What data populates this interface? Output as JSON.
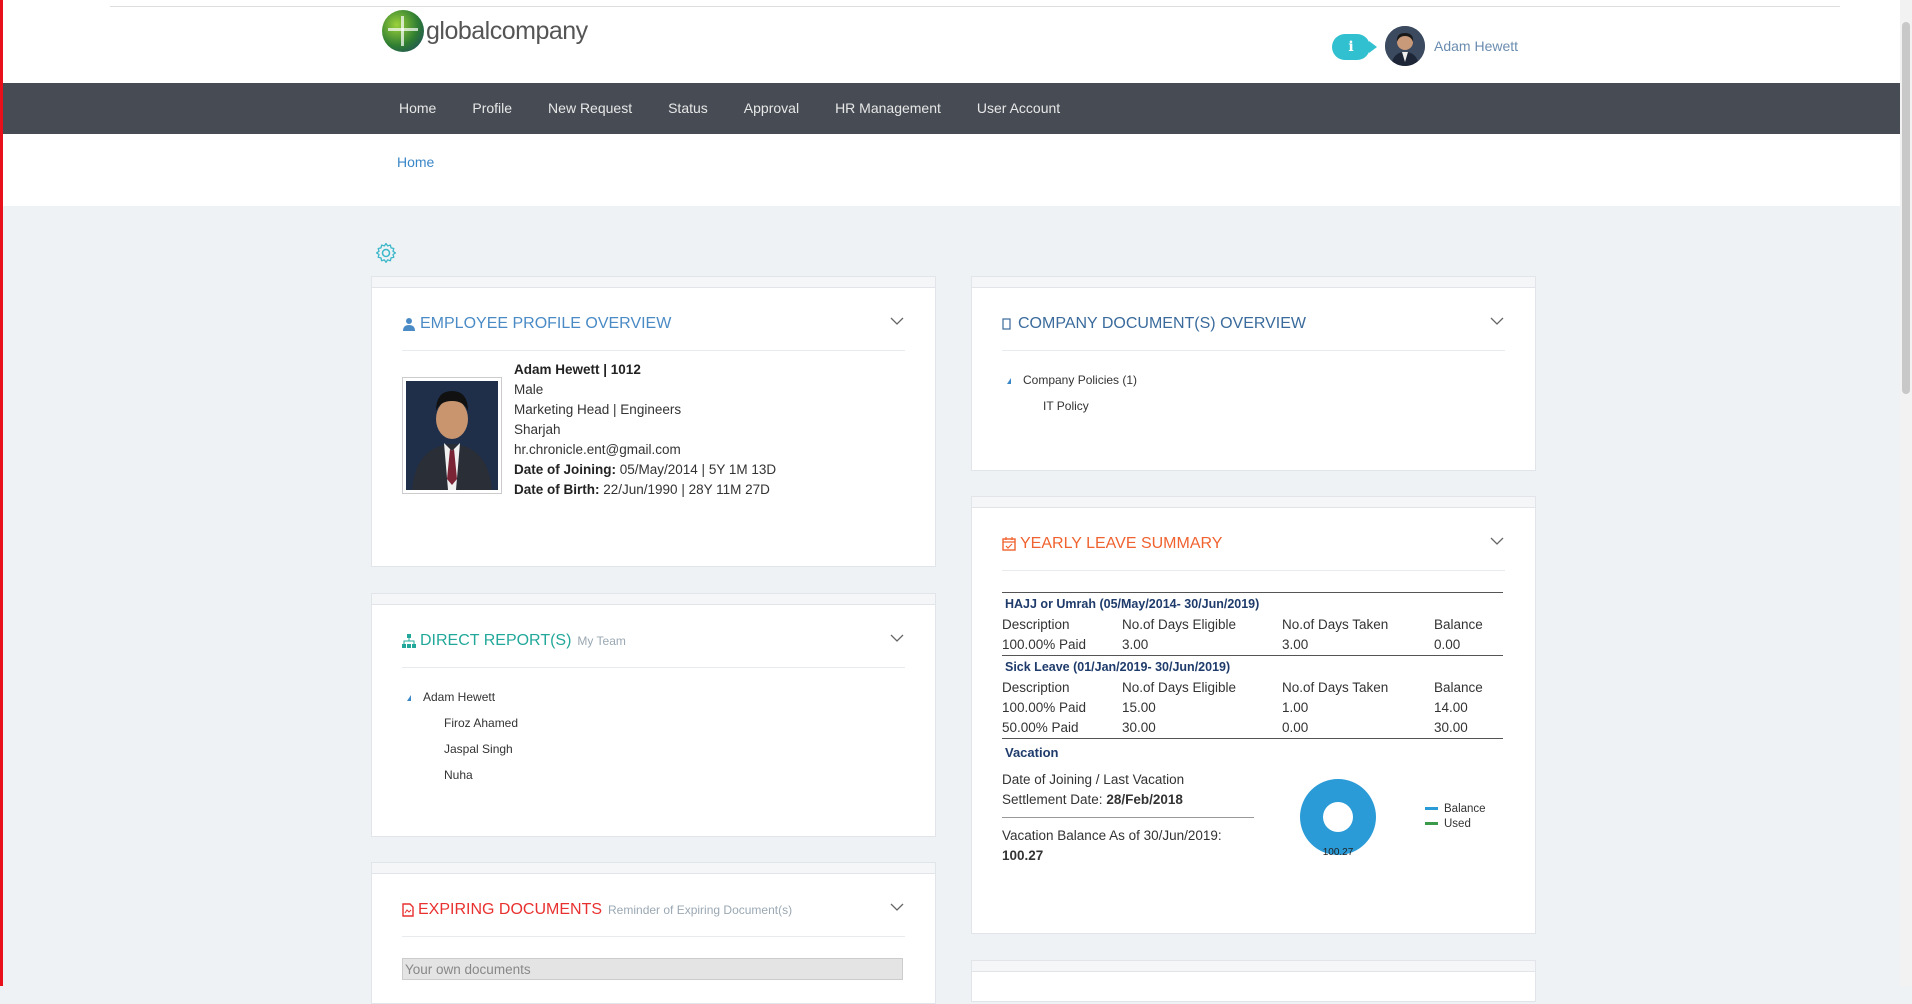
{
  "header": {
    "brand": "globalcompany",
    "info_icon": "i",
    "user_name": "Adam Hewett"
  },
  "nav": {
    "items": [
      "Home",
      "Profile",
      "New Request",
      "Status",
      "Approval",
      "HR Management",
      "User Account"
    ]
  },
  "breadcrumb": {
    "home": "Home"
  },
  "profile": {
    "title": "EMPLOYEE PROFILE OVERVIEW",
    "name_id": "Adam Hewett | 1012",
    "gender": "Male",
    "designation": "Marketing Head | Engineers",
    "location": "Sharjah",
    "email": "hr.chronicle.ent@gmail.com",
    "doj_label": "Date of Joining:",
    "doj_value": " 05/May/2014 | 5Y 1M 13D",
    "dob_label": "Date of Birth:",
    "dob_value": " 22/Jun/1990 | 28Y 11M 27D"
  },
  "reports": {
    "title": "DIRECT REPORT(S)",
    "subtitle": "My Team",
    "manager": "Adam Hewett",
    "members": [
      "Firoz Ahamed",
      "Jaspal Singh",
      "Nuha"
    ]
  },
  "expiring": {
    "title": "EXPIRING DOCUMENTS",
    "subtitle": "Reminder of Expiring Document(s)",
    "placeholder": "Your own documents"
  },
  "company_docs": {
    "title": "COMPANY DOCUMENT(S) OVERVIEW",
    "folder": "Company Policies (1)",
    "items": [
      "IT Policy"
    ]
  },
  "leave": {
    "title": "YEARLY LEAVE SUMMARY",
    "headers": [
      "Description",
      "No.of Days Eligible",
      "No.of Days Taken",
      "Balance"
    ],
    "hajj": {
      "title": "HAJJ or Umrah (05/May/2014- 30/Jun/2019)",
      "rows": [
        [
          "100.00% Paid",
          "3.00",
          "3.00",
          "0.00"
        ]
      ]
    },
    "sick": {
      "title": "Sick Leave (01/Jan/2019- 30/Jun/2019)",
      "rows": [
        [
          "100.00% Paid",
          "15.00",
          "1.00",
          "14.00"
        ],
        [
          "50.00% Paid",
          "30.00",
          "0.00",
          "30.00"
        ]
      ]
    },
    "vacation": {
      "title": "Vacation",
      "settle_label_1": "Date of Joining / Last Vacation",
      "settle_label_2": "Settlement Date: ",
      "settle_value": "28/Feb/2018",
      "balance_label": "Vacation Balance As of 30/Jun/2019:",
      "balance_value": "100.27",
      "donut_label": "100.27",
      "legend": [
        {
          "name": "Balance",
          "color": "#2b9bd8"
        },
        {
          "name": "Used",
          "color": "#3a9a4a"
        }
      ]
    }
  },
  "chart_data": {
    "type": "pie",
    "categories": [
      "Balance",
      "Used"
    ],
    "values": [
      100.27,
      0
    ],
    "labels": [
      "100.27"
    ],
    "legend": "right"
  }
}
